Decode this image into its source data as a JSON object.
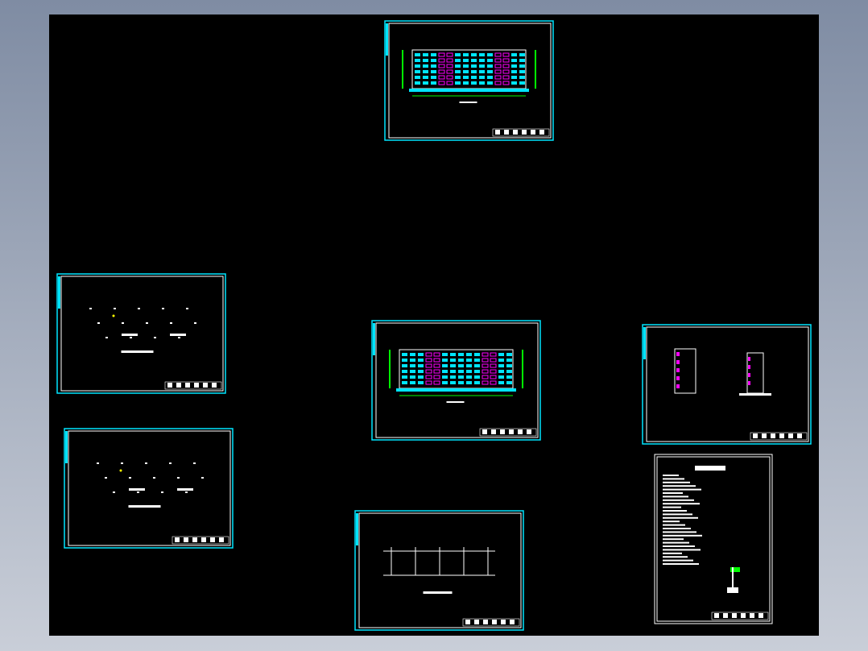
{
  "colors": {
    "background": "#000000",
    "sheet_border": "#00e5ff",
    "frame": "#ffffff",
    "accent_magenta": "#ff00ff",
    "accent_green": "#00ff00",
    "accent_yellow": "#ffff00"
  },
  "sheets": [
    {
      "kind": "elevation"
    },
    {
      "kind": "plan"
    },
    {
      "kind": "elevation"
    },
    {
      "kind": "section"
    },
    {
      "kind": "plan"
    },
    {
      "kind": "foundation"
    },
    {
      "kind": "notes"
    }
  ]
}
